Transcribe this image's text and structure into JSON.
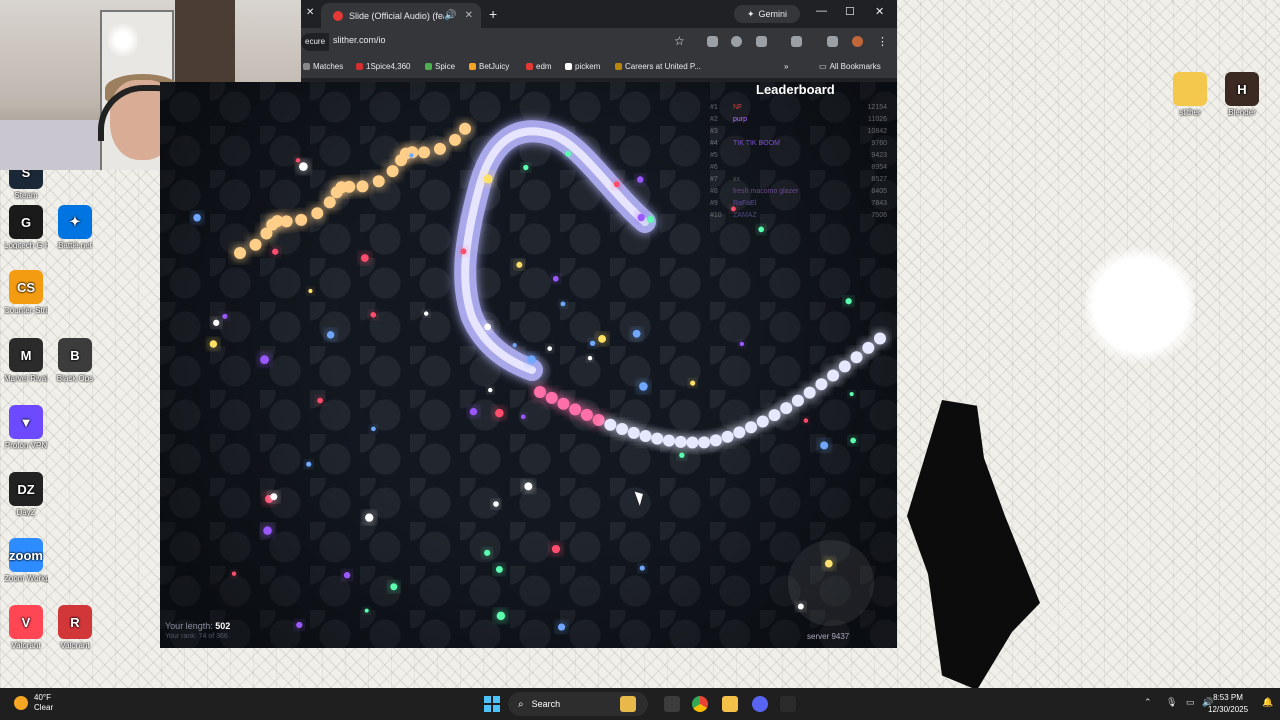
{
  "desktop": {
    "icons": [
      {
        "label": "Steam",
        "icon": "steam-icon",
        "color": "#1b2838",
        "glyph": "S"
      },
      {
        "label": "Logitech G HUB",
        "icon": "logitech-icon",
        "color": "#1a1a1a",
        "glyph": "G"
      },
      {
        "label": "Battle.net",
        "icon": "battlenet-icon",
        "color": "#0074e0",
        "glyph": "✦"
      },
      {
        "label": "Counter-Strike 2",
        "icon": "cs2-icon",
        "color": "#f39c12",
        "glyph": "CS"
      },
      {
        "label": "Marvel Rivals",
        "icon": "marvel-rivals-icon",
        "color": "#2b2b2b",
        "glyph": "M"
      },
      {
        "label": "Black Ops",
        "icon": "blackops-icon",
        "color": "#3c3c3c",
        "glyph": "B"
      },
      {
        "label": "Proton VPN",
        "icon": "proton-vpn-icon",
        "color": "#6d4aff",
        "glyph": "▼"
      },
      {
        "label": "DayZ",
        "icon": "dayz-icon",
        "color": "#222",
        "glyph": "DZ"
      },
      {
        "label": "Zoom Workplace",
        "icon": "zoom-icon",
        "color": "#2d8cff",
        "glyph": "zoom"
      },
      {
        "label": "Valorant",
        "icon": "valorant-icon",
        "color": "#ff4655",
        "glyph": "V"
      },
      {
        "label": "Valorant",
        "icon": "riot-shield-icon",
        "color": "#d13639",
        "glyph": "R"
      },
      {
        "label": "slither",
        "icon": "folder-icon",
        "color": "#f4c84d",
        "glyph": ""
      },
      {
        "label": "Blender",
        "icon": "app-icon",
        "color": "#3a2a22",
        "glyph": "H"
      }
    ]
  },
  "browser": {
    "tab_title": "Slide (Official Audio) (feat.",
    "new_tab": "+",
    "gemini_label": "Gemini",
    "secure_label": "ecure",
    "url": "slither.com/io",
    "bookmarks": [
      {
        "label": "Matches",
        "color": "#888"
      },
      {
        "label": "1Spice4,360",
        "color": "#d32f2f"
      },
      {
        "label": "Spice",
        "color": "#4caf50"
      },
      {
        "label": "BetJuicy",
        "color": "#f5a623"
      },
      {
        "label": "edm",
        "color": "#e53935"
      },
      {
        "label": "pickem",
        "color": "#fff"
      },
      {
        "label": "Careers at United P...",
        "color": "#b8860b"
      }
    ],
    "all_bookmarks": "All Bookmarks"
  },
  "game": {
    "leaderboard_title": "Leaderboard",
    "leaderboard": [
      {
        "rank": "#1",
        "name": "NF",
        "score": "12154",
        "color": "#e53935"
      },
      {
        "rank": "#2",
        "name": "purp",
        "score": "11026",
        "color": "#b36bff"
      },
      {
        "rank": "#3",
        "name": "",
        "score": "10842",
        "color": "#999"
      },
      {
        "rank": "#4",
        "name": "TIK TIK BOOM",
        "score": "9760",
        "color": "#7b4fd1"
      },
      {
        "rank": "#5",
        "name": "",
        "score": "9423",
        "color": "#999"
      },
      {
        "rank": "#6",
        "name": "",
        "score": "8954",
        "color": "#999"
      },
      {
        "rank": "#7",
        "name": "xx",
        "score": "8527",
        "color": "#555"
      },
      {
        "rank": "#8",
        "name": "fresh macomo glazer",
        "score": "8405",
        "color": "#6a4a8c"
      },
      {
        "rank": "#9",
        "name": "RaFaEl",
        "score": "7843",
        "color": "#5c4b9c"
      },
      {
        "rank": "#10",
        "name": "ZAMAZ",
        "score": "7506",
        "color": "#4a4a7a"
      }
    ],
    "length_label": "Your length:",
    "length_value": "502",
    "rank_text": "Your rank: 74 of 366",
    "server": "server 9437"
  },
  "taskbar": {
    "temperature": "40°F",
    "condition": "Clear",
    "search_placeholder": "Search",
    "time": "8:53 PM",
    "date": "12/30/2025"
  }
}
